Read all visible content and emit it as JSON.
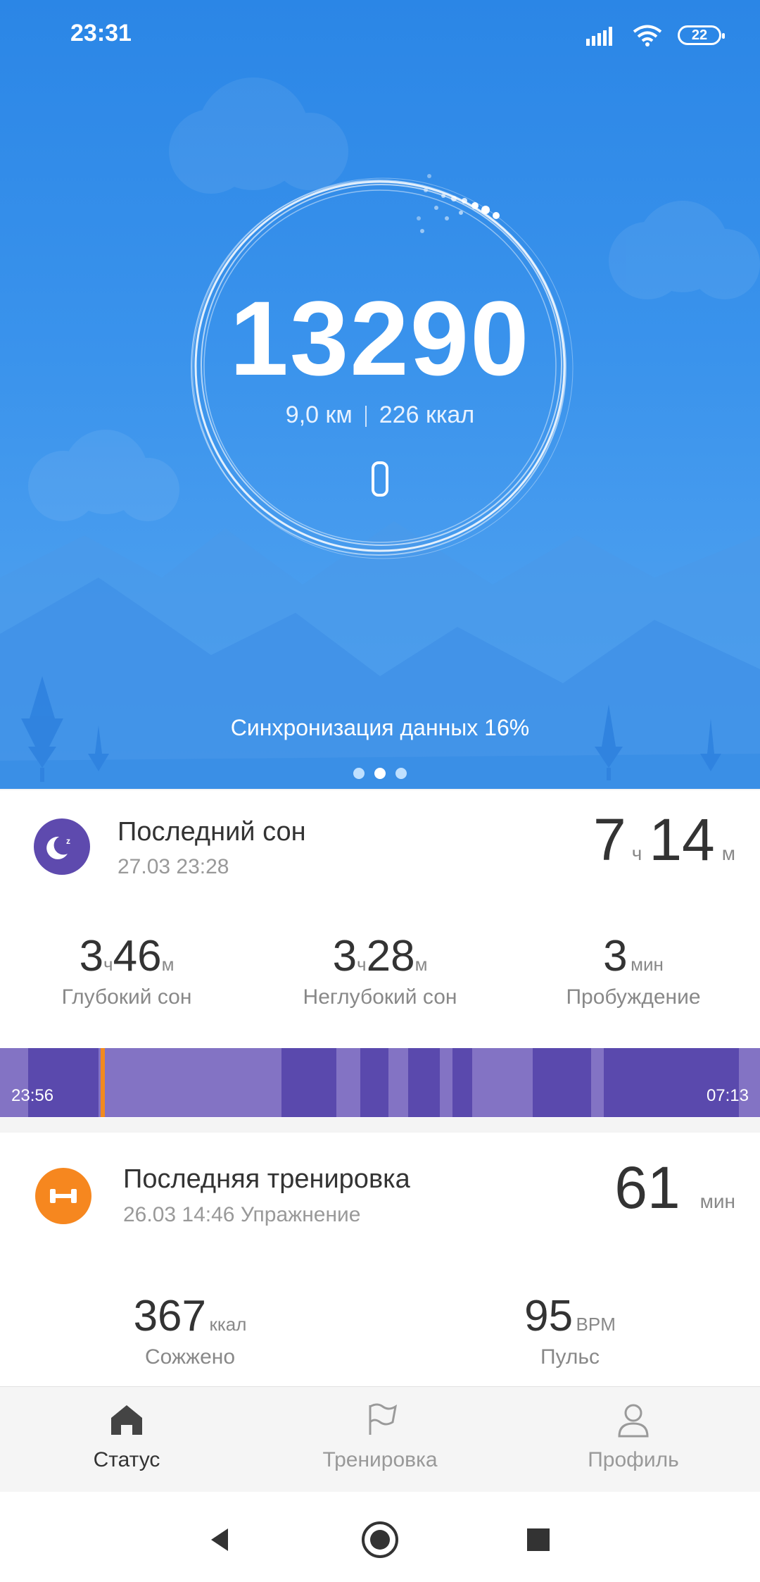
{
  "status_bar": {
    "time": "23:31",
    "battery": "22"
  },
  "hero": {
    "steps": "13290",
    "distance": "9,0 км",
    "calories": "226 ккал",
    "sync_text": "Синхронизация данных 16%"
  },
  "sleep": {
    "title": "Последний сон",
    "date": "27.03 23:28",
    "total": {
      "hours": "7",
      "hours_unit": "ч",
      "minutes": "14",
      "minutes_unit": "м"
    },
    "deep": {
      "h": "3",
      "h_unit": "ч",
      "m": "46",
      "m_unit": "м",
      "label": "Глубокий сон"
    },
    "light": {
      "h": "3",
      "h_unit": "ч",
      "m": "28",
      "m_unit": "м",
      "label": "Неглубокий сон"
    },
    "awake": {
      "value": "3",
      "unit": "мин",
      "label": "Пробуждение"
    },
    "start_time": "23:56",
    "end_time": "07:13"
  },
  "workout": {
    "title": "Последняя тренировка",
    "subtitle": "26.03 14:46 Упражнение",
    "duration": "61",
    "duration_unit": "мин",
    "calories": "367",
    "calories_unit": "ккал",
    "calories_label": "Сожжено",
    "pulse": "95",
    "pulse_unit": "BPM",
    "pulse_label": "Пульс"
  },
  "bottom_nav": {
    "status": "Статус",
    "workout": "Тренировка",
    "profile": "Профиль"
  },
  "colors": {
    "hero_blue": "#2b86e6",
    "sleep_purple": "#5e4aae",
    "workout_orange": "#f6871f"
  }
}
